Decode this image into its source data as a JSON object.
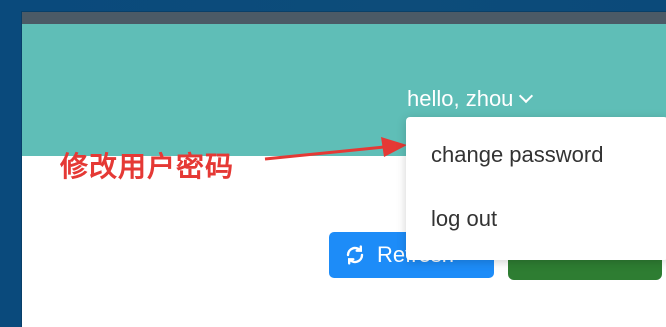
{
  "header": {
    "user_label": "hello, zhou",
    "icon": "chevron-down-icon",
    "bg_color": "#5fbeb7"
  },
  "annotation": {
    "text": "修改用户密码",
    "color": "#e53935"
  },
  "dropdown": {
    "items": [
      {
        "label": "change password"
      },
      {
        "label": "log out"
      }
    ]
  },
  "toolbar": {
    "refresh_label": "Refresh",
    "refresh_icon": "refresh-icon",
    "refresh_color": "#1d8cf8",
    "green_button_color": "#2e7d32"
  }
}
